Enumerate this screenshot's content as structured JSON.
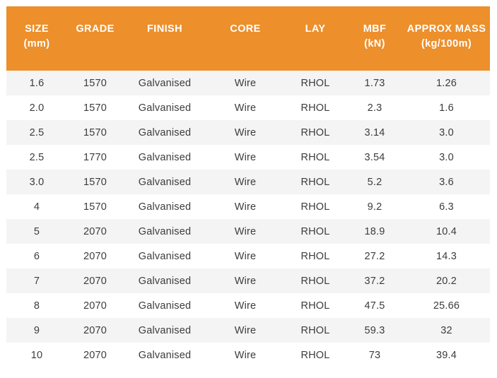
{
  "theme": {
    "header_bg": "#ed8f2b",
    "header_text": "#ffffff",
    "row_stripe_bg": "#f4f4f4",
    "row_plain_bg": "#ffffff",
    "body_text": "#3c3c3c",
    "page_bg": "#ffffff"
  },
  "table": {
    "columns": [
      {
        "key": "size",
        "label": "SIZE",
        "unit": "(mm)"
      },
      {
        "key": "grade",
        "label": "GRADE",
        "unit": ""
      },
      {
        "key": "finish",
        "label": "FINISH",
        "unit": ""
      },
      {
        "key": "core",
        "label": "CORE",
        "unit": ""
      },
      {
        "key": "lay",
        "label": "LAY",
        "unit": ""
      },
      {
        "key": "mbf",
        "label": "MBF",
        "unit": "(kN)"
      },
      {
        "key": "mass",
        "label": "APPROX MASS",
        "unit": "(kg/100m)"
      }
    ],
    "rows": [
      {
        "size": "1.6",
        "grade": "1570",
        "finish": "Galvanised",
        "core": "Wire",
        "lay": "RHOL",
        "mbf": "1.73",
        "mass": "1.26"
      },
      {
        "size": "2.0",
        "grade": "1570",
        "finish": "Galvanised",
        "core": "Wire",
        "lay": "RHOL",
        "mbf": "2.3",
        "mass": "1.6"
      },
      {
        "size": "2.5",
        "grade": "1570",
        "finish": "Galvanised",
        "core": "Wire",
        "lay": "RHOL",
        "mbf": "3.14",
        "mass": "3.0"
      },
      {
        "size": "2.5",
        "grade": "1770",
        "finish": "Galvanised",
        "core": "Wire",
        "lay": "RHOL",
        "mbf": "3.54",
        "mass": "3.0"
      },
      {
        "size": "3.0",
        "grade": "1570",
        "finish": "Galvanised",
        "core": "Wire",
        "lay": "RHOL",
        "mbf": "5.2",
        "mass": "3.6"
      },
      {
        "size": "4",
        "grade": "1570",
        "finish": "Galvanised",
        "core": "Wire",
        "lay": "RHOL",
        "mbf": "9.2",
        "mass": "6.3"
      },
      {
        "size": "5",
        "grade": "2070",
        "finish": "Galvanised",
        "core": "Wire",
        "lay": "RHOL",
        "mbf": "18.9",
        "mass": "10.4"
      },
      {
        "size": "6",
        "grade": "2070",
        "finish": "Galvanised",
        "core": "Wire",
        "lay": "RHOL",
        "mbf": "27.2",
        "mass": "14.3"
      },
      {
        "size": "7",
        "grade": "2070",
        "finish": "Galvanised",
        "core": "Wire",
        "lay": "RHOL",
        "mbf": "37.2",
        "mass": "20.2"
      },
      {
        "size": "8",
        "grade": "2070",
        "finish": "Galvanised",
        "core": "Wire",
        "lay": "RHOL",
        "mbf": "47.5",
        "mass": "25.66"
      },
      {
        "size": "9",
        "grade": "2070",
        "finish": "Galvanised",
        "core": "Wire",
        "lay": "RHOL",
        "mbf": "59.3",
        "mass": "32"
      },
      {
        "size": "10",
        "grade": "2070",
        "finish": "Galvanised",
        "core": "Wire",
        "lay": "RHOL",
        "mbf": "73",
        "mass": "39.4"
      }
    ]
  }
}
